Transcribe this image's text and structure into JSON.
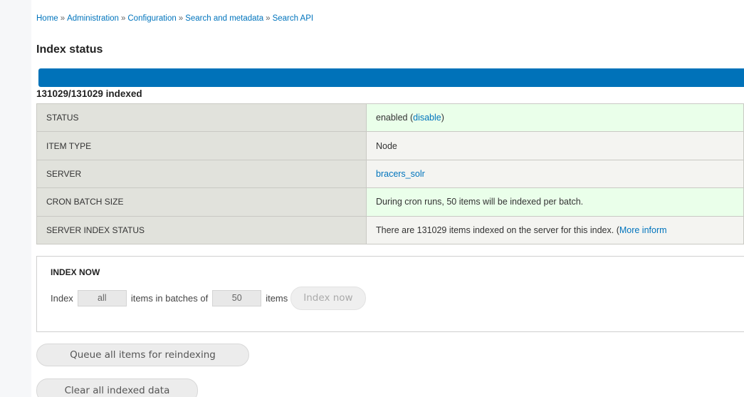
{
  "breadcrumb": {
    "items": [
      "Home",
      "Administration",
      "Configuration",
      "Search and metadata",
      "Search API"
    ],
    "separator": "»"
  },
  "page_title": "Index status",
  "progress": {
    "fraction": 1.0,
    "text": "131029/131029 indexed",
    "color": "#0072b9"
  },
  "info_table": {
    "rows": [
      {
        "label": "STATUS",
        "value_prefix": "enabled (",
        "link": "disable",
        "value_suffix": ")"
      },
      {
        "label": "ITEM TYPE",
        "value": "Node"
      },
      {
        "label": "SERVER",
        "link": "bracers_solr"
      },
      {
        "label": "CRON BATCH SIZE",
        "value": "During cron runs, 50 items will be indexed per batch."
      },
      {
        "label": "SERVER INDEX STATUS",
        "value_prefix": "There are 131029 items indexed on the server for this index. (",
        "link": "More inform"
      }
    ]
  },
  "index_now": {
    "legend": "INDEX NOW",
    "label_index": "Index",
    "limit_value": "all",
    "label_batches": "items in batches of",
    "batch_value": "50",
    "label_items": "items",
    "button": "Index now"
  },
  "actions": {
    "queue_button": "Queue all items for reindexing",
    "clear_button": "Clear all indexed data"
  }
}
